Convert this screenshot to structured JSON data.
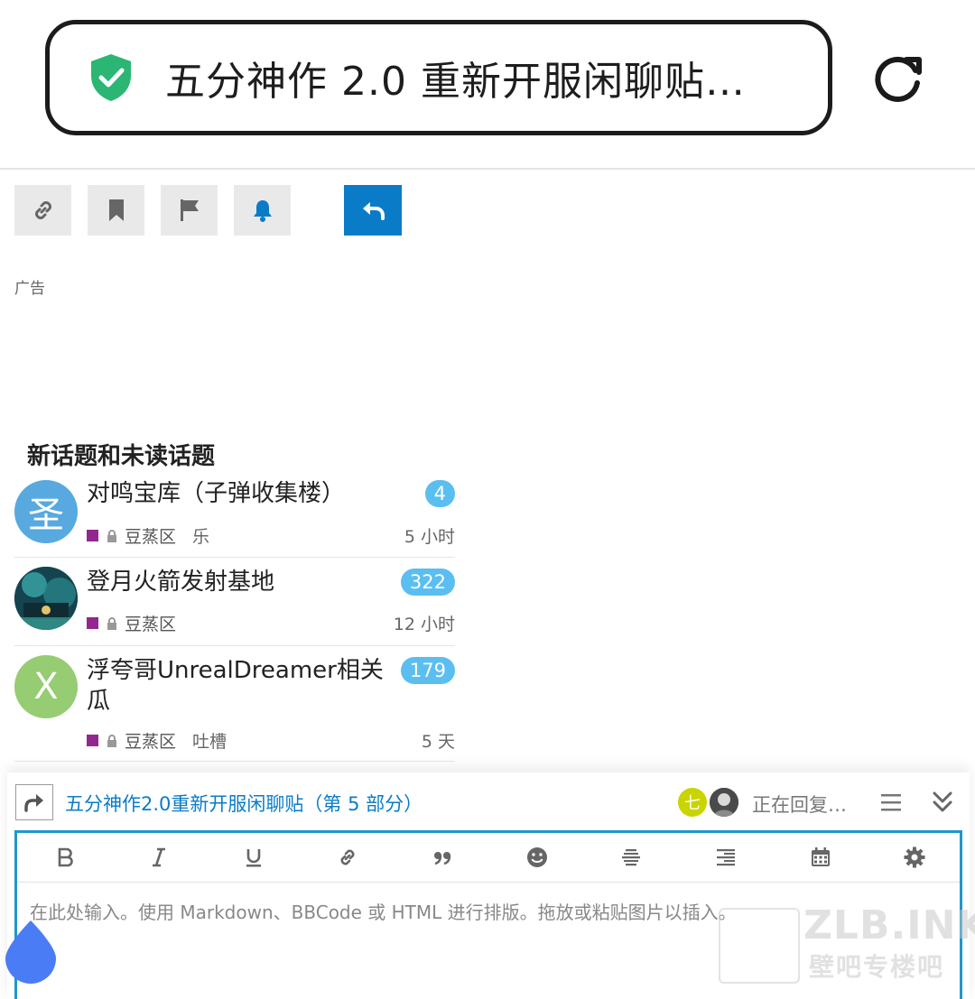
{
  "browser": {
    "url_title": "五分神作 2.0 重新开服闲聊贴…"
  },
  "ad": {
    "label": "广告"
  },
  "section": {
    "title": "新话题和未读话题"
  },
  "topics": [
    {
      "avatar_letter": "圣",
      "avatar_color": "#57a9e0",
      "title": "对鸣宝库（子弹收集楼）",
      "badge": "4",
      "category": "豆蒸区",
      "tag": "乐",
      "time": "5 小时"
    },
    {
      "avatar_letter": "",
      "avatar_color": "#1d5d6d",
      "title": "登月火箭发射基地",
      "badge": "322",
      "category": "豆蒸区",
      "tag": "",
      "time": "12 小时"
    },
    {
      "avatar_letter": "X",
      "avatar_color": "#96cc72",
      "title": "浮夸哥UnrealDreamer相关瓜",
      "badge": "179",
      "category": "豆蒸区",
      "tag": "吐槽",
      "time": "5 天"
    }
  ],
  "composer": {
    "reply_title": "五分神作2.0重新开服闲聊贴（第 5 部分）",
    "avatar_letter": "七",
    "avatar_color": "#c9d400",
    "replying_text": "正在回复…",
    "placeholder": "在此处输入。使用 Markdown、BBCode 或 HTML 进行排版。拖放或粘贴图片以插入。"
  },
  "watermark": {
    "line1": "ZLB.INK",
    "line2": "壁吧专楼吧"
  },
  "colors": {
    "accent": "#0a7cc7",
    "badge": "#5bbef0",
    "category": "#92278f",
    "shield": "#2bb673"
  }
}
